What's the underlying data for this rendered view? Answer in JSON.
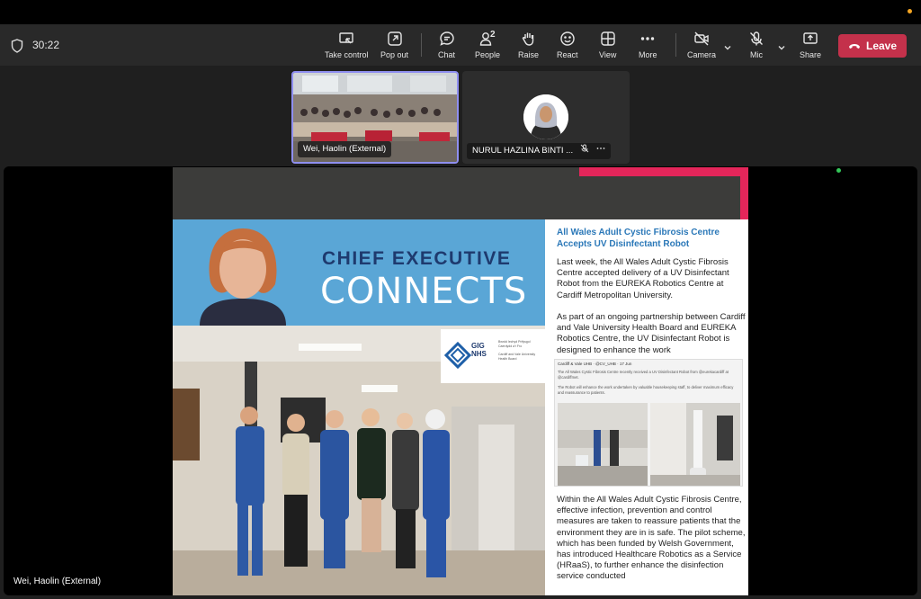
{
  "meeting": {
    "timer": "30:22",
    "toolbar": {
      "take_control": "Take control",
      "pop_out": "Pop out",
      "chat": "Chat",
      "people": "People",
      "people_count": "2",
      "raise": "Raise",
      "react": "React",
      "view": "View",
      "more": "More",
      "camera": "Camera",
      "mic": "Mic",
      "share": "Share",
      "leave": "Leave"
    },
    "participants": [
      {
        "name": "Wei, Haolin (External)"
      },
      {
        "name": "NURUL HAZLINA BINTI ..."
      }
    ],
    "stage_presenter": "Wei, Haolin (External)"
  },
  "slide": {
    "banner_title": "CHIEF EXECUTIVE",
    "banner_subtitle": "CONNECTS",
    "logo": {
      "mark": "GIG NHS",
      "welsh_text": "Bwrdd Iechyd Prifysgol Caerdydd a'r Fro",
      "english_text": "Cardiff and Vale University Health Board"
    },
    "article": {
      "headline": "All Wales Adult Cystic Fibrosis Centre Accepts UV Disinfectant Robot",
      "p1": "Last week, the All Wales Adult Cystic Fibrosis Centre accepted delivery of a UV Disinfectant Robot from the EUREKA Robotics Centre at Cardiff Metropolitan University.",
      "p2": "As part of an ongoing partnership between Cardiff and Vale University Health Board and EUREKA Robotics Centre, the UV Disinfectant Robot is designed to enhance the work",
      "p3": "Within the All Wales Adult Cystic Fibrosis Centre, effective infection, prevention and control measures are taken to reassure patients that the environment they are in is safe. The pilot scheme, which has been funded by Welsh Government, has introduced Healthcare Robotics as a Service (HRaaS), to further enhance the disinfection service conducted"
    },
    "tweet": {
      "header": "Cardiff & Vale UHB · @CV_UHB · 17 Jun",
      "line1": "The All Wales Cystic Fibrosis Centre recently received a UV Disinfectant Robot from @eurekacardiff at @cardiffmet.",
      "line2": "The Robot will enhance the work undertaken by valuable housekeeping staff, to deliver maximum efficacy and reassurance to patients."
    }
  },
  "colors": {
    "leave": "#c4314b",
    "active_border": "#8f8ff0",
    "banner": "#5aa6d6",
    "accent_red": "#e4265a",
    "headline_blue": "#2b78b8"
  }
}
